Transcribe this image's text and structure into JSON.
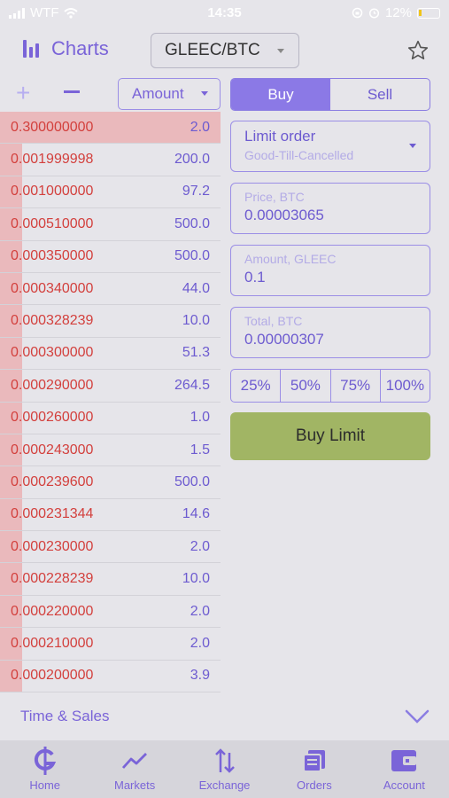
{
  "status_bar": {
    "carrier": "WTF",
    "time": "14:35",
    "battery": "12%"
  },
  "header": {
    "charts_label": "Charts",
    "pair": "GLEEC/BTC"
  },
  "orderbook": {
    "amount_select": "Amount",
    "rows": [
      {
        "price": "0.300000000",
        "amount": "2.0",
        "depth": 1.0
      },
      {
        "price": "0.001999998",
        "amount": "200.0",
        "depth": 0.1
      },
      {
        "price": "0.001000000",
        "amount": "97.2",
        "depth": 0.1
      },
      {
        "price": "0.000510000",
        "amount": "500.0",
        "depth": 0.1
      },
      {
        "price": "0.000350000",
        "amount": "500.0",
        "depth": 0.1
      },
      {
        "price": "0.000340000",
        "amount": "44.0",
        "depth": 0.1
      },
      {
        "price": "0.000328239",
        "amount": "10.0",
        "depth": 0.1
      },
      {
        "price": "0.000300000",
        "amount": "51.3",
        "depth": 0.1
      },
      {
        "price": "0.000290000",
        "amount": "264.5",
        "depth": 0.1
      },
      {
        "price": "0.000260000",
        "amount": "1.0",
        "depth": 0.1
      },
      {
        "price": "0.000243000",
        "amount": "1.5",
        "depth": 0.1
      },
      {
        "price": "0.000239600",
        "amount": "500.0",
        "depth": 0.1
      },
      {
        "price": "0.000231344",
        "amount": "14.6",
        "depth": 0.1
      },
      {
        "price": "0.000230000",
        "amount": "2.0",
        "depth": 0.1
      },
      {
        "price": "0.000228239",
        "amount": "10.0",
        "depth": 0.1
      },
      {
        "price": "0.000220000",
        "amount": "2.0",
        "depth": 0.1
      },
      {
        "price": "0.000210000",
        "amount": "2.0",
        "depth": 0.1
      },
      {
        "price": "0.000200000",
        "amount": "3.9",
        "depth": 0.1
      }
    ]
  },
  "trade": {
    "tab_buy": "Buy",
    "tab_sell": "Sell",
    "order_type": "Limit order",
    "order_time": "Good-Till-Cancelled",
    "price_label": "Price, BTC",
    "price_value": "0.00003065",
    "amount_label": "Amount, GLEEC",
    "amount_value": "0.1",
    "total_label": "Total, BTC",
    "total_value": "0.00000307",
    "percents": [
      "25%",
      "50%",
      "75%",
      "100%"
    ],
    "submit": "Buy Limit"
  },
  "time_sales": {
    "label": "Time & Sales"
  },
  "nav": {
    "items": [
      "Home",
      "Markets",
      "Exchange",
      "Orders",
      "Account"
    ]
  },
  "colors": {
    "accent": "#7a64d8",
    "ask": "#d3403d",
    "buy_button": "#a1b564"
  }
}
